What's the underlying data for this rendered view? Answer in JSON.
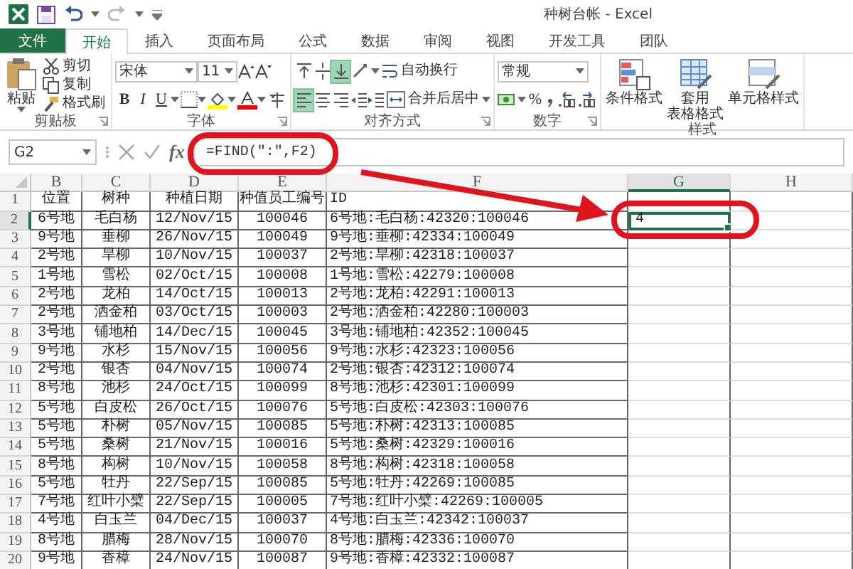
{
  "window": {
    "title": "种树台帐 - Excel"
  },
  "tabs": [
    {
      "label": "文件",
      "kind": "file",
      "selected": false
    },
    {
      "label": "开始",
      "kind": "tab",
      "selected": true
    },
    {
      "label": "插入",
      "kind": "tab",
      "selected": false
    },
    {
      "label": "页面布局",
      "kind": "tab",
      "selected": false
    },
    {
      "label": "公式",
      "kind": "tab",
      "selected": false
    },
    {
      "label": "数据",
      "kind": "tab",
      "selected": false
    },
    {
      "label": "审阅",
      "kind": "tab",
      "selected": false
    },
    {
      "label": "视图",
      "kind": "tab",
      "selected": false
    },
    {
      "label": "开发工具",
      "kind": "tab",
      "selected": false
    },
    {
      "label": "团队",
      "kind": "tab",
      "selected": false
    }
  ],
  "ribbon": {
    "groups": [
      {
        "kind": "clipboard",
        "label": "剪贴板",
        "paste": "粘贴",
        "buttons": [
          "剪切",
          "复制",
          "格式刷"
        ]
      },
      {
        "kind": "font",
        "label": "字体",
        "font": "宋体",
        "size": "11",
        "styles": [
          "B",
          "I",
          "U"
        ]
      },
      {
        "kind": "alignment",
        "label": "对齐方式",
        "wrap": "自动换行",
        "merge": "合并后居中",
        "vertical_align": [
          {
            "selected": false
          },
          {
            "selected": false
          },
          {
            "selected": true
          }
        ],
        "horizontal_align": [
          {
            "selected": true
          },
          {
            "selected": false
          },
          {
            "selected": false
          }
        ]
      },
      {
        "kind": "number",
        "label": "数字",
        "format": "常规",
        "percent": "%"
      },
      {
        "kind": "styles",
        "label": "样式",
        "buttons": [
          {
            "lines": [
              "条件格式"
            ]
          },
          {
            "lines": [
              "套用",
              "表格格式"
            ]
          },
          {
            "lines": [
              "单元格样式"
            ]
          }
        ]
      }
    ]
  },
  "formula_bar": {
    "name_box": "G2",
    "fx_label": "fx",
    "formula": "=FIND(\":\",F2)"
  },
  "sheet": {
    "columns": [
      {
        "label": "B",
        "selected": false
      },
      {
        "label": "C",
        "selected": false
      },
      {
        "label": "D",
        "selected": false
      },
      {
        "label": "E",
        "selected": false
      },
      {
        "label": "F",
        "selected": false
      },
      {
        "label": "G",
        "selected": true
      },
      {
        "label": "H",
        "selected": false
      }
    ],
    "rows": [
      {
        "num": "1",
        "selected": false,
        "cells": [
          "位置",
          "树种",
          "种植日期",
          "种值员工编号",
          "ID"
        ]
      },
      {
        "num": "2",
        "selected": true,
        "cells": [
          "6号地",
          "毛白杨",
          "12/Nov/15",
          "100046",
          "6号地:毛白杨:42320:100046",
          "4"
        ]
      },
      {
        "num": "3",
        "selected": false,
        "cells": [
          "9号地",
          "垂柳",
          "26/Nov/15",
          "100049",
          "9号地:垂柳:42334:100049"
        ]
      },
      {
        "num": "4",
        "selected": false,
        "cells": [
          "2号地",
          "旱柳",
          "10/Nov/15",
          "100037",
          "2号地:旱柳:42318:100037"
        ]
      },
      {
        "num": "5",
        "selected": false,
        "cells": [
          "1号地",
          "雪松",
          "02/Oct/15",
          "100008",
          "1号地:雪松:42279:100008"
        ]
      },
      {
        "num": "6",
        "selected": false,
        "cells": [
          "2号地",
          "龙柏",
          "14/Oct/15",
          "100013",
          "2号地:龙柏:42291:100013"
        ]
      },
      {
        "num": "7",
        "selected": false,
        "cells": [
          "2号地",
          "洒金柏",
          "03/Oct/15",
          "100003",
          "2号地:洒金柏:42280:100003"
        ]
      },
      {
        "num": "8",
        "selected": false,
        "cells": [
          "3号地",
          "铺地柏",
          "14/Dec/15",
          "100045",
          "3号地:铺地柏:42352:100045"
        ]
      },
      {
        "num": "9",
        "selected": false,
        "cells": [
          "9号地",
          "水杉",
          "15/Nov/15",
          "100056",
          "9号地:水杉:42323:100056"
        ]
      },
      {
        "num": "10",
        "selected": false,
        "cells": [
          "2号地",
          "银杏",
          "04/Nov/15",
          "100074",
          "2号地:银杏:42312:100074"
        ]
      },
      {
        "num": "11",
        "selected": false,
        "cells": [
          "8号地",
          "池杉",
          "24/Oct/15",
          "100099",
          "8号地:池杉:42301:100099"
        ]
      },
      {
        "num": "12",
        "selected": false,
        "cells": [
          "5号地",
          "白皮松",
          "26/Oct/15",
          "100076",
          "5号地:白皮松:42303:100076"
        ]
      },
      {
        "num": "13",
        "selected": false,
        "cells": [
          "5号地",
          "朴树",
          "05/Nov/15",
          "100085",
          "5号地:朴树:42313:100085"
        ]
      },
      {
        "num": "14",
        "selected": false,
        "cells": [
          "5号地",
          "桑树",
          "21/Nov/15",
          "100016",
          "5号地:桑树:42329:100016"
        ]
      },
      {
        "num": "15",
        "selected": false,
        "cells": [
          "8号地",
          "构树",
          "10/Nov/15",
          "100058",
          "8号地:构树:42318:100058"
        ]
      },
      {
        "num": "16",
        "selected": false,
        "cells": [
          "5号地",
          "牡丹",
          "22/Sep/15",
          "100085",
          "5号地:牡丹:42269:100085"
        ]
      },
      {
        "num": "17",
        "selected": false,
        "cells": [
          "7号地",
          "红叶小檗",
          "22/Sep/15",
          "100005",
          "7号地:红叶小檗:42269:100005"
        ]
      },
      {
        "num": "18",
        "selected": false,
        "cells": [
          "4号地",
          "白玉兰",
          "04/Dec/15",
          "100037",
          "4号地:白玉兰:42342:100037"
        ]
      },
      {
        "num": "19",
        "selected": false,
        "cells": [
          "8号地",
          "腊梅",
          "28/Nov/15",
          "100070",
          "8号地:腊梅:42336:100070"
        ]
      },
      {
        "num": "20",
        "selected": false,
        "cells": [
          "9号地",
          "香樟",
          "24/Nov/15",
          "100087",
          "9号地:香樟:42332:100087"
        ]
      }
    ]
  }
}
